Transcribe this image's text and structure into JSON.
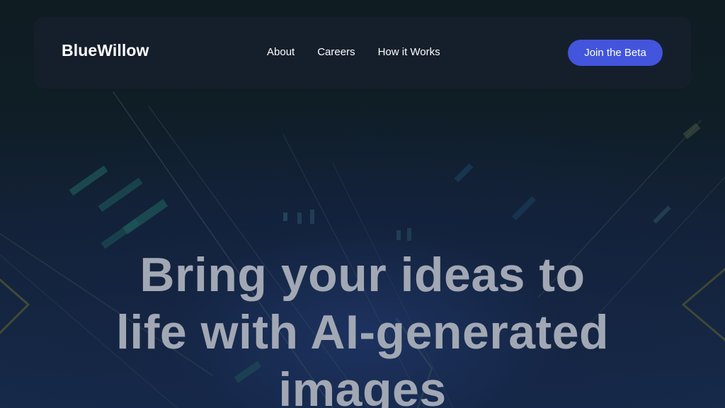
{
  "navbar": {
    "brand": "BlueWillow",
    "links": [
      {
        "label": "About"
      },
      {
        "label": "Careers"
      },
      {
        "label": "How it Works"
      }
    ],
    "cta_label": "Join the Beta"
  },
  "hero": {
    "title": "Bring your ideas to life with AI-generated images"
  },
  "colors": {
    "accent": "#4255dc",
    "navbar_bg": "#151f2c",
    "hero_text": "#a1a8b4"
  }
}
